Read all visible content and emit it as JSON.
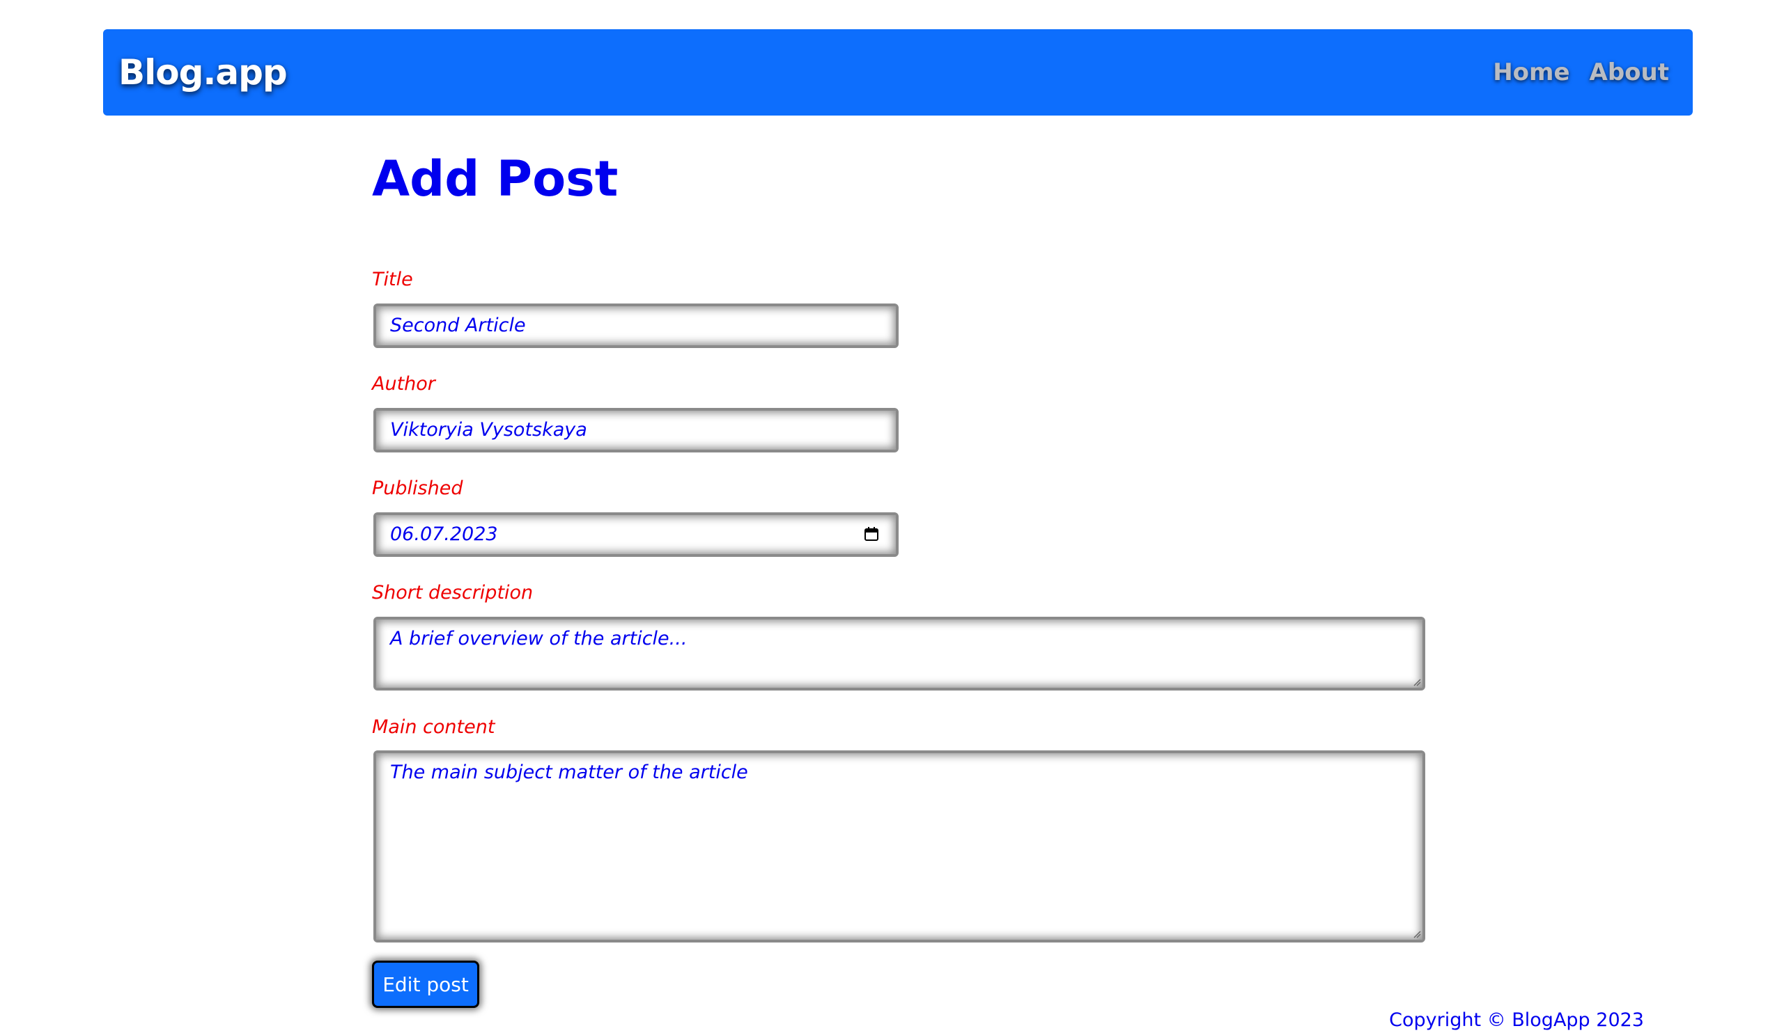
{
  "app": {
    "brand": "Blog.app"
  },
  "nav": {
    "links": [
      {
        "label": "Home"
      },
      {
        "label": "About"
      }
    ]
  },
  "page": {
    "title": "Add Post"
  },
  "form": {
    "title": {
      "label": "Title",
      "value": "Second Article"
    },
    "author": {
      "label": "Author",
      "value": "Viktoryia Vysotskaya"
    },
    "published": {
      "label": "Published",
      "value": "06.07.2023",
      "icon": "calendar-icon"
    },
    "short_description": {
      "label": "Short description",
      "value": "A brief overview of the article..."
    },
    "main_content": {
      "label": "Main content",
      "value": "The main subject matter of the article"
    },
    "submit_label": "Edit post"
  },
  "footer": {
    "copyright": "Copyright © BlogApp 2023"
  },
  "colors": {
    "navbar": "#0d6efd",
    "heading": "#0000ee",
    "label": "#ee0000",
    "value": "#0000ee",
    "button": "#0d6efd"
  }
}
